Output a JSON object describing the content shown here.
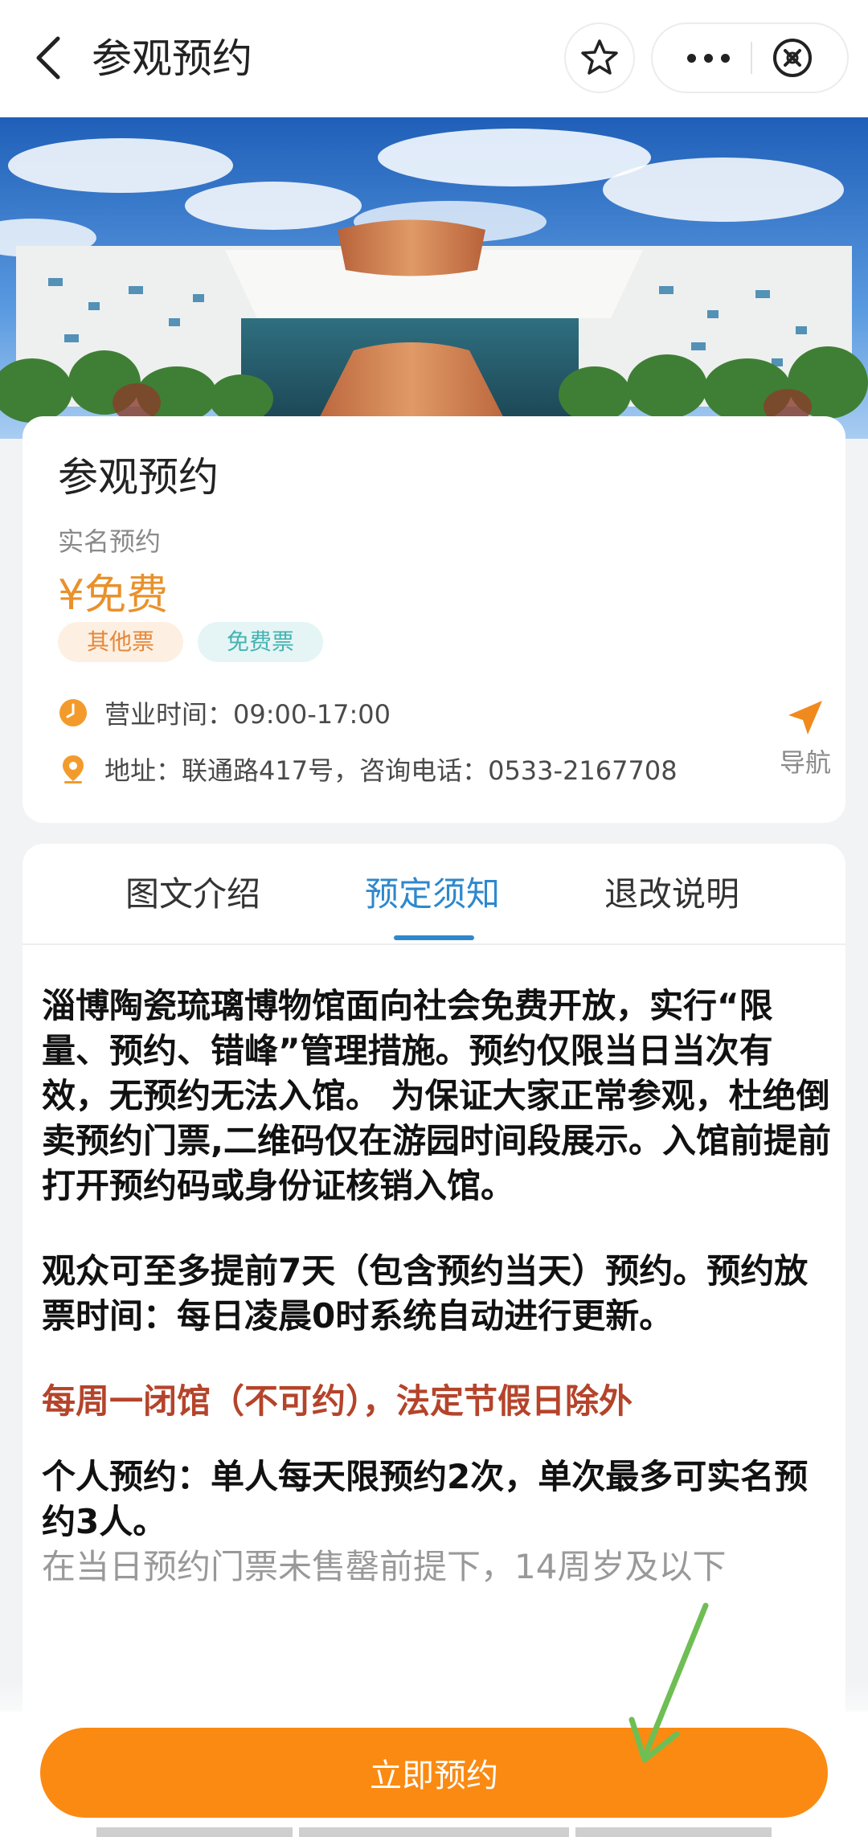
{
  "header": {
    "title": "参观预约",
    "back_icon": "chevron-left-icon",
    "favorite_icon": "star-icon",
    "more_icon": "more-dots-icon",
    "close_icon": "close-circle-icon"
  },
  "info": {
    "title": "参观预约",
    "subtitle": "实名预约",
    "price": "¥免费",
    "tags": [
      "其他票",
      "免费票"
    ],
    "hours": "营业时间：09:00-17:00",
    "address": "地址：联通路417号，咨询电话：0533-2167708",
    "nav_label": "导航",
    "colors": {
      "price": "#e9912b",
      "accent": "#fb8a12",
      "tab_active": "#2e88cd"
    }
  },
  "tabs": [
    {
      "label": "图文介绍",
      "active": false
    },
    {
      "label": "预定须知",
      "active": true
    },
    {
      "label": "退改说明",
      "active": false
    }
  ],
  "notice": {
    "p1": "淄博陶瓷琉璃博物馆面向社会免费开放，实行“限量、预约、错峰”管理措施。预约仅限当日当次有效，无预约无法入馆。 为保证大家正常参观，杜绝倒卖预约门票,二维码仅在游园时间段展示。入馆前提前打开预约码或身份证核销入馆。",
    "p2": "观众可至多提前7天（包含预约当天）预约。预约放票时间：每日凌晨0时系统自动进行更新。",
    "p3": "每周一闭馆（不可约），法定节假日除外",
    "p4": "个人预约：单人每天限预约2次，单次最多可实名预约3人。",
    "p5": "在当日预约门票未售罄前提下，14周岁及以下"
  },
  "footer": {
    "reserve_label": "立即预约"
  }
}
